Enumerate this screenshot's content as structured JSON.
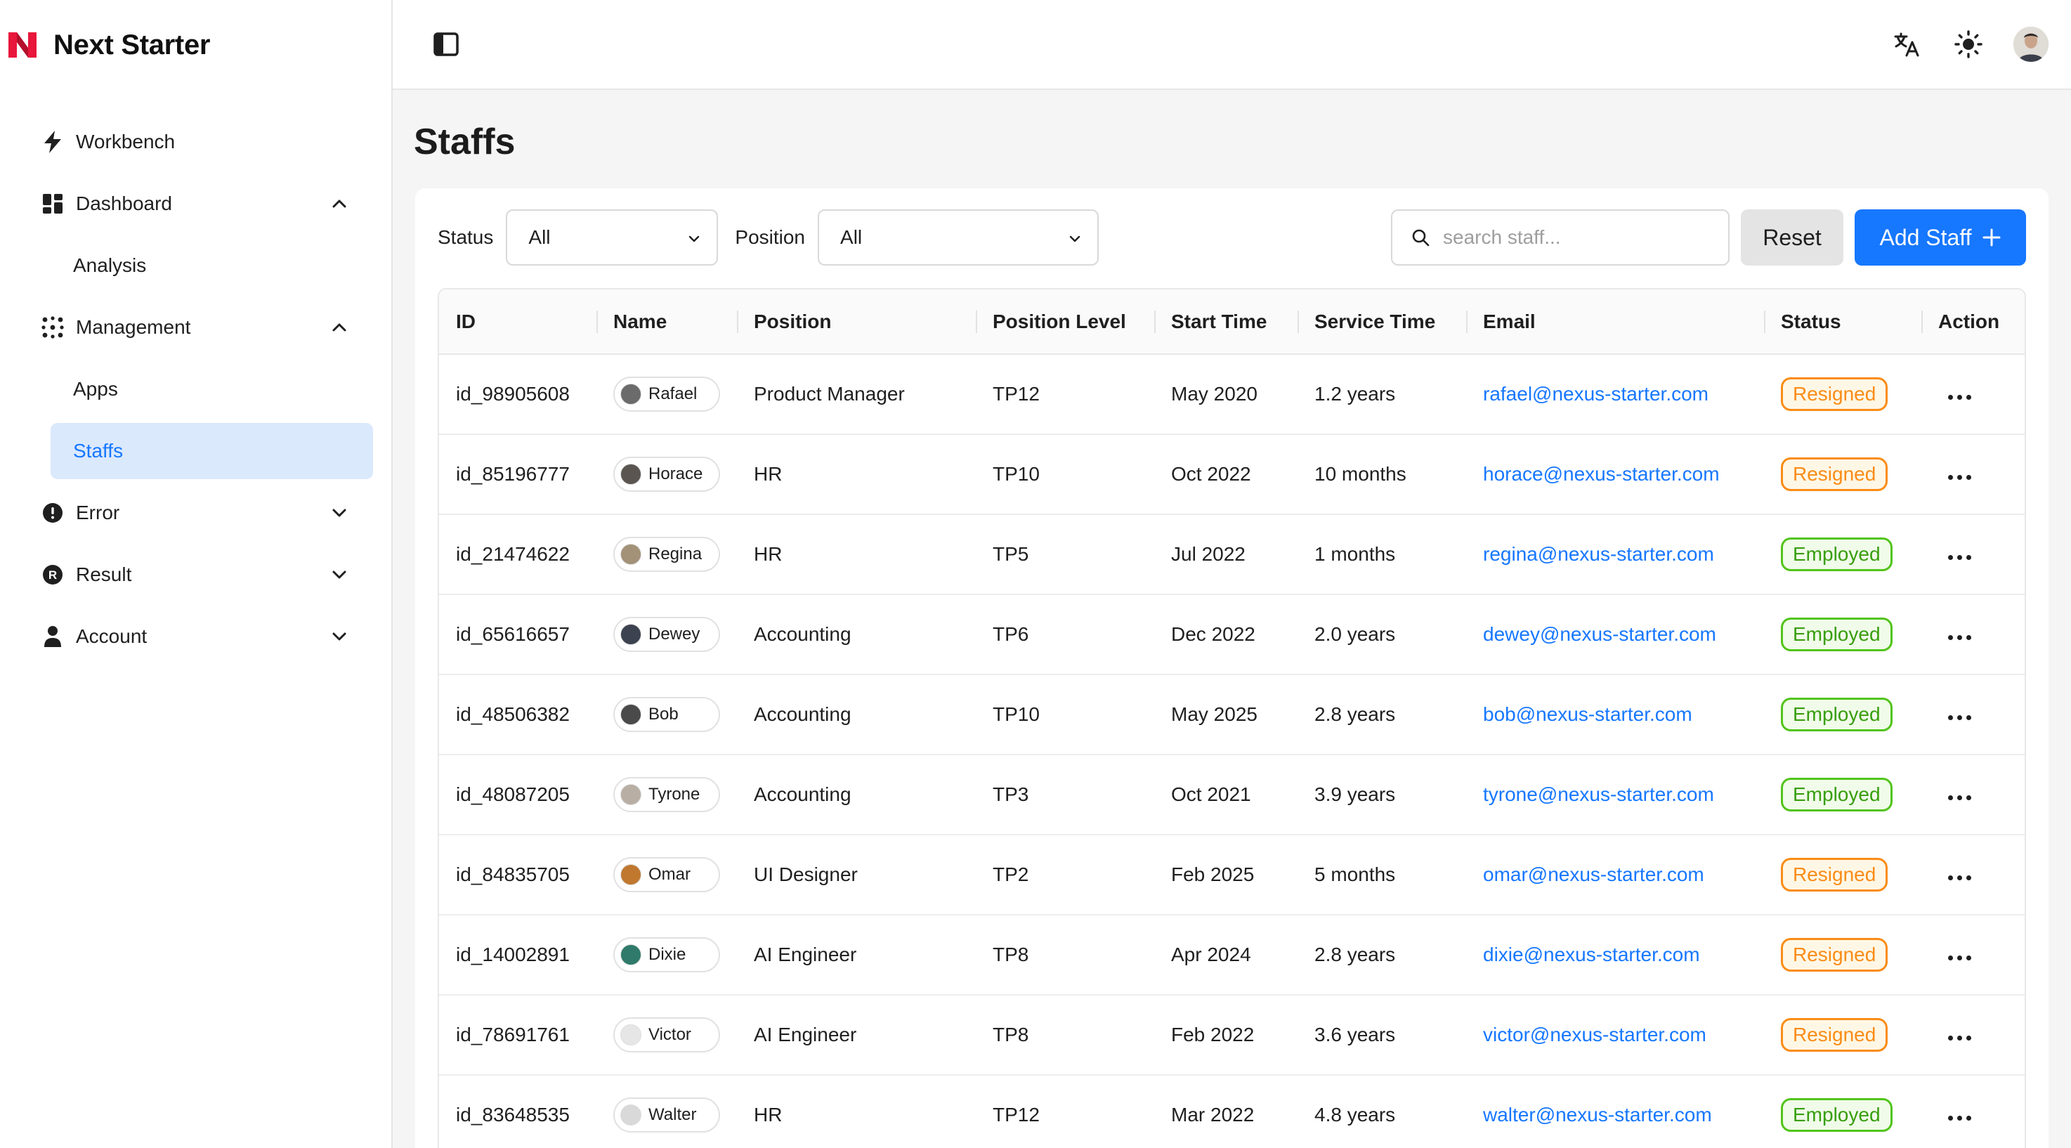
{
  "app": {
    "name": "Next Starter",
    "brand_color": "#e8173b"
  },
  "sidebar": {
    "items": [
      {
        "label": "Workbench",
        "icon": "bolt-icon"
      },
      {
        "label": "Dashboard",
        "icon": "dashboard-icon",
        "expanded": true,
        "children": [
          "Analysis"
        ]
      },
      {
        "label": "Management",
        "icon": "grid-dots-icon",
        "expanded": true,
        "children": [
          "Apps",
          "Staffs"
        ]
      },
      {
        "label": "Error",
        "icon": "exclamation-circle-icon",
        "expanded": false
      },
      {
        "label": "Result",
        "icon": "r-circle-icon",
        "expanded": false
      },
      {
        "label": "Account",
        "icon": "user-icon",
        "expanded": false
      }
    ],
    "active": "Staffs"
  },
  "header": {
    "tools": [
      "translate-icon",
      "sun-icon",
      "user-avatar"
    ]
  },
  "page": {
    "title": "Staffs"
  },
  "filters": {
    "status_label": "Status",
    "status_value": "All",
    "position_label": "Position",
    "position_value": "All",
    "search_placeholder": "search staff...",
    "reset_label": "Reset",
    "add_label": "Add Staff"
  },
  "table": {
    "columns": [
      "ID",
      "Name",
      "Position",
      "Position Level",
      "Start Time",
      "Service Time",
      "Email",
      "Status",
      "Action"
    ],
    "rows": [
      {
        "id": "id_98905608",
        "name": "Rafael",
        "position": "Product Manager",
        "level": "TP12",
        "start": "May 2020",
        "service": "1.2 years",
        "email": "rafael@nexus-starter.com",
        "status": "Resigned",
        "avatar": "#6b6b6b"
      },
      {
        "id": "id_85196777",
        "name": "Horace",
        "position": "HR",
        "level": "TP10",
        "start": "Oct 2022",
        "service": "10 months",
        "email": "horace@nexus-starter.com",
        "status": "Resigned",
        "avatar": "#5a5550"
      },
      {
        "id": "id_21474622",
        "name": "Regina",
        "position": "HR",
        "level": "TP5",
        "start": "Jul 2022",
        "service": "1 months",
        "email": "regina@nexus-starter.com",
        "status": "Employed",
        "avatar": "#a39178"
      },
      {
        "id": "id_65616657",
        "name": "Dewey",
        "position": "Accounting",
        "level": "TP6",
        "start": "Dec 2022",
        "service": "2.0 years",
        "email": "dewey@nexus-starter.com",
        "status": "Employed",
        "avatar": "#3d4250"
      },
      {
        "id": "id_48506382",
        "name": "Bob",
        "position": "Accounting",
        "level": "TP10",
        "start": "May 2025",
        "service": "2.8 years",
        "email": "bob@nexus-starter.com",
        "status": "Employed",
        "avatar": "#4a4a4a"
      },
      {
        "id": "id_48087205",
        "name": "Tyrone",
        "position": "Accounting",
        "level": "TP3",
        "start": "Oct 2021",
        "service": "3.9 years",
        "email": "tyrone@nexus-starter.com",
        "status": "Employed",
        "avatar": "#b8aea4"
      },
      {
        "id": "id_84835705",
        "name": "Omar",
        "position": "UI Designer",
        "level": "TP2",
        "start": "Feb 2025",
        "service": "5 months",
        "email": "omar@nexus-starter.com",
        "status": "Resigned",
        "avatar": "#c0782f"
      },
      {
        "id": "id_14002891",
        "name": "Dixie",
        "position": "AI Engineer",
        "level": "TP8",
        "start": "Apr 2024",
        "service": "2.8 years",
        "email": "dixie@nexus-starter.com",
        "status": "Resigned",
        "avatar": "#2f7a6a"
      },
      {
        "id": "id_78691761",
        "name": "Victor",
        "position": "AI Engineer",
        "level": "TP8",
        "start": "Feb 2022",
        "service": "3.6 years",
        "email": "victor@nexus-starter.com",
        "status": "Resigned",
        "avatar": "#e6e6e6"
      },
      {
        "id": "id_83648535",
        "name": "Walter",
        "position": "HR",
        "level": "TP12",
        "start": "Mar 2022",
        "service": "4.8 years",
        "email": "walter@nexus-starter.com",
        "status": "Employed",
        "avatar": "#d9d9d9"
      }
    ]
  }
}
